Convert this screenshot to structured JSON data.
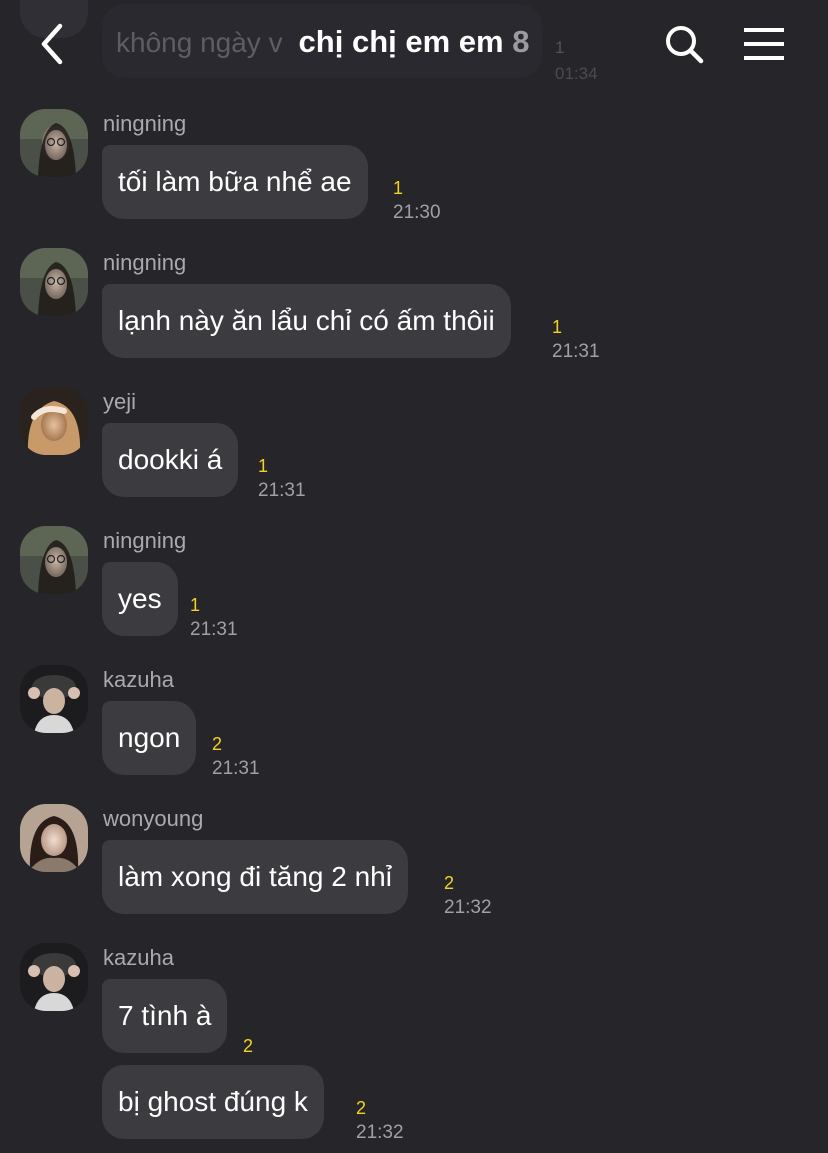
{
  "header": {
    "title": "chị chị em em",
    "member_count": "8",
    "back_icon": "chevron-left-icon",
    "search_icon": "search-icon",
    "menu_icon": "hamburger-menu-icon"
  },
  "previous_message": {
    "text": "không ngày v",
    "unread": "1",
    "time": "01:34"
  },
  "messages": [
    {
      "sender": "ningning",
      "text": "tối làm bữa nhể ae",
      "unread": "1",
      "time": "21:30"
    },
    {
      "sender": "ningning",
      "text": "lạnh này ăn lẩu chỉ có ấm thôii",
      "unread": "1",
      "time": "21:31"
    },
    {
      "sender": "yeji",
      "text": "dookki á",
      "unread": "1",
      "time": "21:31"
    },
    {
      "sender": "ningning",
      "text": "yes",
      "unread": "1",
      "time": "21:31"
    },
    {
      "sender": "kazuha",
      "text": "ngon",
      "unread": "2",
      "time": "21:31"
    },
    {
      "sender": "wonyoung",
      "text": "làm xong đi tăng 2 nhỉ",
      "unread": "2",
      "time": "21:32"
    },
    {
      "sender": "kazuha",
      "text": "7 tình à",
      "unread": "2",
      "time": ""
    },
    {
      "sender": "",
      "text": "bị ghost đúng k",
      "unread": "2",
      "time": "21:32"
    }
  ],
  "colors": {
    "background": "#25252a",
    "bubble": "#3b3b40",
    "unread": "#f4d31f",
    "meta_text": "#a0a0a6"
  }
}
